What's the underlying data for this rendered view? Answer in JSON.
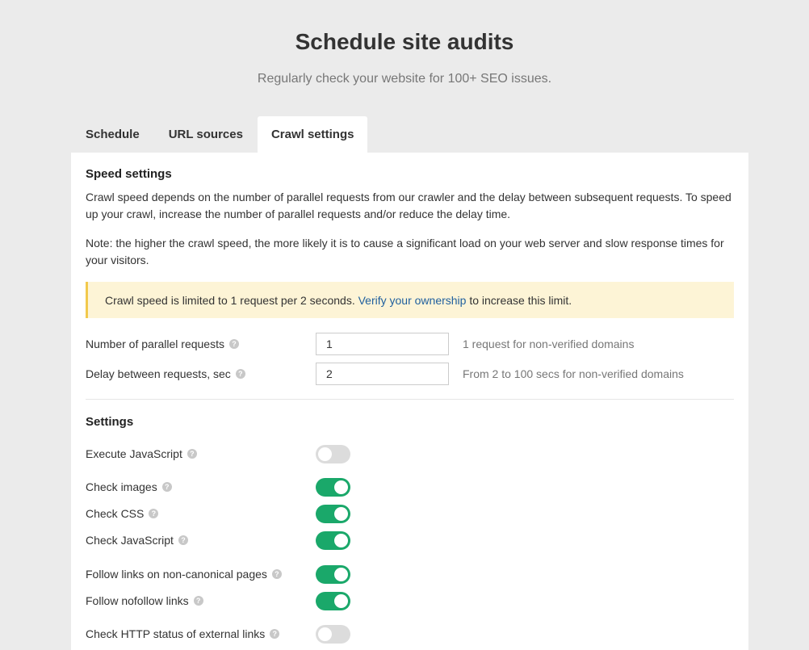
{
  "header": {
    "title": "Schedule site audits",
    "subtitle": "Regularly check your website for 100+ SEO issues."
  },
  "tabs": [
    {
      "label": "Schedule",
      "active": false
    },
    {
      "label": "URL sources",
      "active": false
    },
    {
      "label": "Crawl settings",
      "active": true
    }
  ],
  "speed": {
    "title": "Speed settings",
    "description": "Crawl speed depends on the number of parallel requests from our crawler and the delay between subsequent requests. To speed up your crawl, increase the number of parallel requests and/or reduce the delay time.",
    "note": "Note: the higher the crawl speed, the more likely it is to cause a significant load on your web server and slow response times for your visitors.",
    "notice": {
      "before": "Crawl speed is limited to 1 request per 2 seconds.",
      "link": "Verify your ownership",
      "after": "to increase this limit."
    },
    "fields": [
      {
        "label": "Number of parallel requests",
        "value": "1",
        "hint": "1 request for non-verified domains"
      },
      {
        "label": "Delay between requests, sec",
        "value": "2",
        "hint": "From 2 to 100 secs for non-verified domains"
      }
    ]
  },
  "settings": {
    "title": "Settings",
    "toggles": [
      {
        "label": "Execute JavaScript",
        "on": false
      },
      {
        "label": "Check images",
        "on": true
      },
      {
        "label": "Check CSS",
        "on": true
      },
      {
        "label": "Check JavaScript",
        "on": true
      },
      {
        "label": "Follow links on non-canonical pages",
        "on": true
      },
      {
        "label": "Follow nofollow links",
        "on": true
      },
      {
        "label": "Check HTTP status of external links",
        "on": false
      }
    ]
  },
  "icons": {
    "help": "question-mark-icon"
  },
  "colors": {
    "toggle_on": "#1aa86a",
    "toggle_off": "#dcdcdc",
    "link": "#1f5f9e",
    "notice_bg": "#fdf4d6",
    "notice_border": "#f2c94c"
  }
}
